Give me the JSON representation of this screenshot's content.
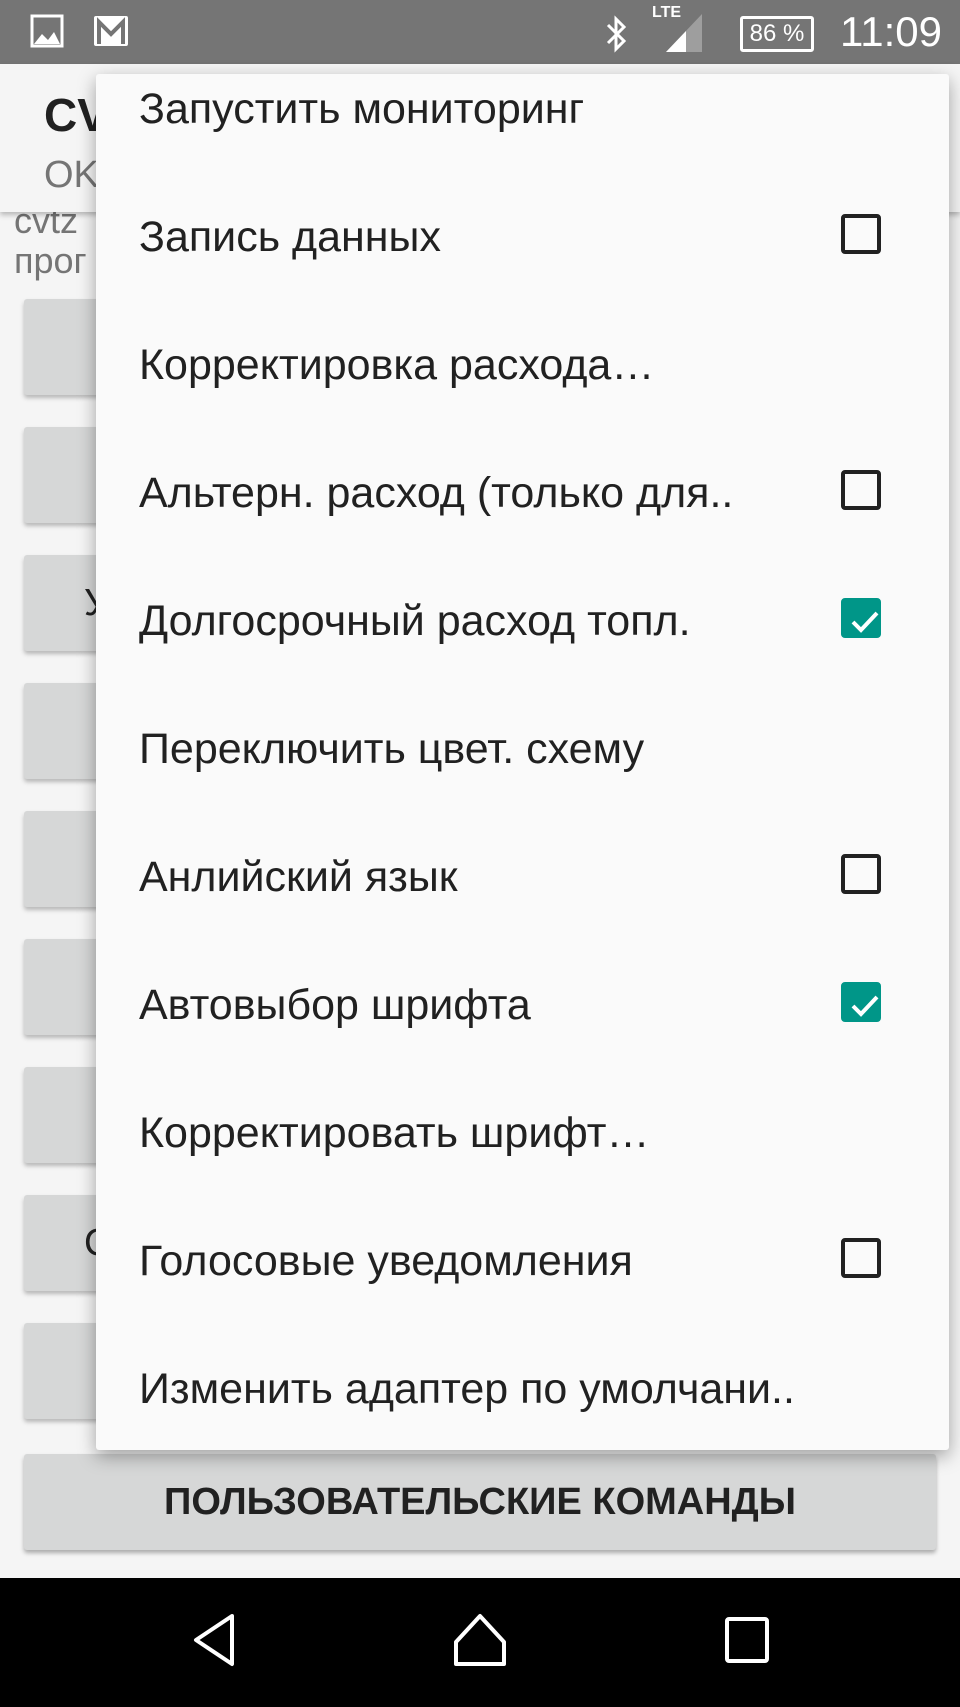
{
  "status_bar": {
    "left_icons": [
      "image-icon",
      "gmail-icon"
    ],
    "right_icons": [
      "bluetooth-icon",
      "lte-signal-icon",
      "battery-icon"
    ],
    "network_label": "LTE",
    "battery_percent": "86 %",
    "time": "11:09"
  },
  "app_bar": {
    "title": "CV",
    "subtitle": "OK"
  },
  "background": {
    "line1": "cvtz",
    "line2": "прог",
    "button_fragments": [
      "",
      "",
      "У",
      "",
      "",
      "",
      "",
      "С",
      ""
    ],
    "custom_commands_button": "ПОЛЬЗОВАТЕЛЬСКИЕ КОМАНДЫ"
  },
  "menu": {
    "accent_color": "#009688",
    "items": [
      {
        "label": "Запустить мониторинг",
        "checkbox": false
      },
      {
        "label": "Запись данных",
        "checkbox": true,
        "checked": false
      },
      {
        "label": "Корректировка расхода…",
        "checkbox": false
      },
      {
        "label": "Альтерн. расход (только для..",
        "checkbox": true,
        "checked": false
      },
      {
        "label": "Долгосрочный расход топл.",
        "checkbox": true,
        "checked": true
      },
      {
        "label": "Переключить цвет. схему",
        "checkbox": false
      },
      {
        "label": "Анлийский язык",
        "checkbox": true,
        "checked": false
      },
      {
        "label": "Автовыбор шрифта",
        "checkbox": true,
        "checked": true
      },
      {
        "label": "Корректировать шрифт…",
        "checkbox": false
      },
      {
        "label": "Голосовые уведомления",
        "checkbox": true,
        "checked": false
      },
      {
        "label": "Изменить адаптер по умолчани..",
        "checkbox": false
      }
    ]
  },
  "nav_bar": {
    "buttons": [
      "back-icon",
      "home-icon",
      "recents-icon"
    ]
  }
}
